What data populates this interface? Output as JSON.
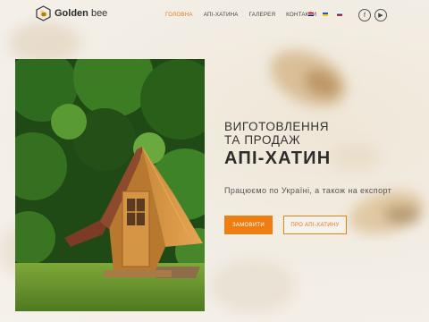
{
  "brand": {
    "name_bold": "Golden",
    "name_light": " bee",
    "logo_icon": "bee-hexagon-logo",
    "accent": "#f07d12"
  },
  "nav": {
    "items": [
      {
        "label": "ГОЛОВНА",
        "active": true
      },
      {
        "label": "АПІ-ХАТИНА",
        "active": false
      },
      {
        "label": "ГАЛЕРЕЯ",
        "active": false
      },
      {
        "label": "КОНТАКТИ",
        "active": false
      }
    ]
  },
  "languages": [
    {
      "icon": "flag-en-icon"
    },
    {
      "icon": "flag-ua-icon"
    },
    {
      "icon": "flag-ru-icon"
    }
  ],
  "social": {
    "facebook_glyph": "f",
    "youtube_glyph": "▶",
    "facebook_icon": "facebook-icon",
    "youtube_icon": "youtube-icon"
  },
  "hero": {
    "subtitle": "ВИГОТОВЛЕННЯ\nТА ПРОДАЖ",
    "title": "АПІ-ХАТИН",
    "description": "Працюємо по Україні, а також на експорт",
    "primary_button": "ЗАМОВИТИ",
    "secondary_button": "ПРО АПІ-ХАТИНУ"
  }
}
